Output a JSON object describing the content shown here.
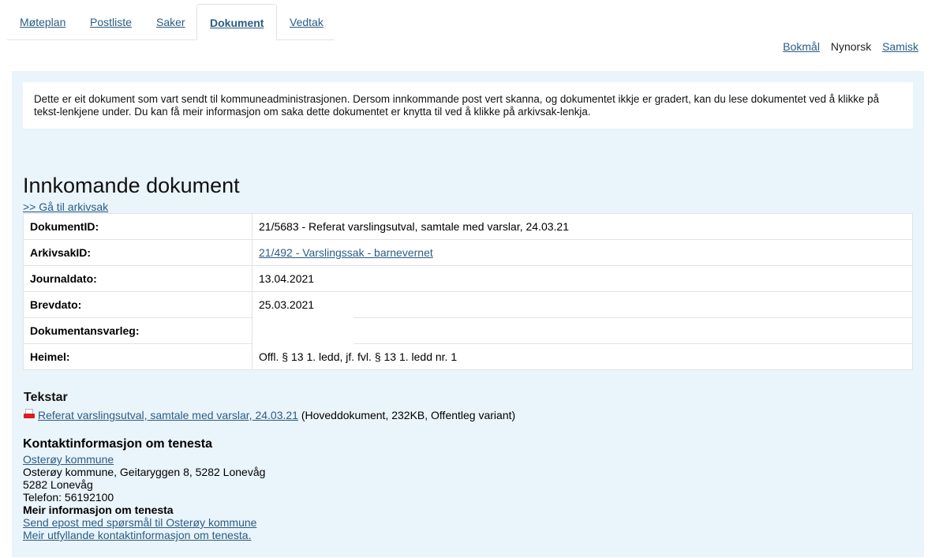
{
  "tabs": [
    {
      "label": "Møteplan"
    },
    {
      "label": "Postliste"
    },
    {
      "label": "Saker"
    },
    {
      "label": "Dokument"
    },
    {
      "label": "Vedtak"
    }
  ],
  "languages": {
    "bokmal": "Bokmål",
    "nynorsk": "Nynorsk",
    "samisk": "Samisk"
  },
  "info_text": "Dette er eit dokument som vart sendt til kommuneadministrasjonen. Dersom innkommande post vert skanna, og dokumentet ikkje er gradert, kan du lese dokumentet ved å klikke på tekst-lenkjene under. Du kan få meir informasjon om saka dette dokumentet er knytta til ved å klikke på arkivsak-lenkja.",
  "document": {
    "title": "Innkomande dokument",
    "back_link": ">> Gå til arkivsak",
    "rows": [
      {
        "key": "DokumentID:",
        "value": "21/5683 - Referat varslingsutval, samtale med varslar, 24.03.21"
      },
      {
        "key": "ArkivsakID:",
        "value": "21/492 - Varslingssak - barnevernet"
      },
      {
        "key": "Journaldato:",
        "value": "13.04.2021"
      },
      {
        "key": "Brevdato:",
        "value": "25.03.2021"
      },
      {
        "key": "Dokumentansvarleg:",
        "value": ""
      },
      {
        "key": "Heimel:",
        "value": "Offl. § 13 1. ledd, jf. fvl. § 13 1. ledd nr. 1"
      }
    ]
  },
  "tekstar": {
    "heading": "Tekstar",
    "file_link": "Referat varslingsutval, samtale med varslar, 24.03.21",
    "file_meta": " (Hoveddokument, 232KB, Offentleg variant)",
    "icon": "pdf-icon"
  },
  "contact": {
    "heading": "Kontaktinformasjon om tenesta",
    "org_link": "Osterøy kommune",
    "address": "Osterøy kommune, Geitaryggen 8, 5282 Lonevåg",
    "postal": "5282 Lonevåg",
    "phone": "Telefon: 56192100",
    "more_heading": "Meir informasjon om tenesta",
    "email_link": "Send epost med spørsmål til Osterøy kommune",
    "more_link": "Meir utfyllande kontaktinformasjon om tenesta."
  }
}
